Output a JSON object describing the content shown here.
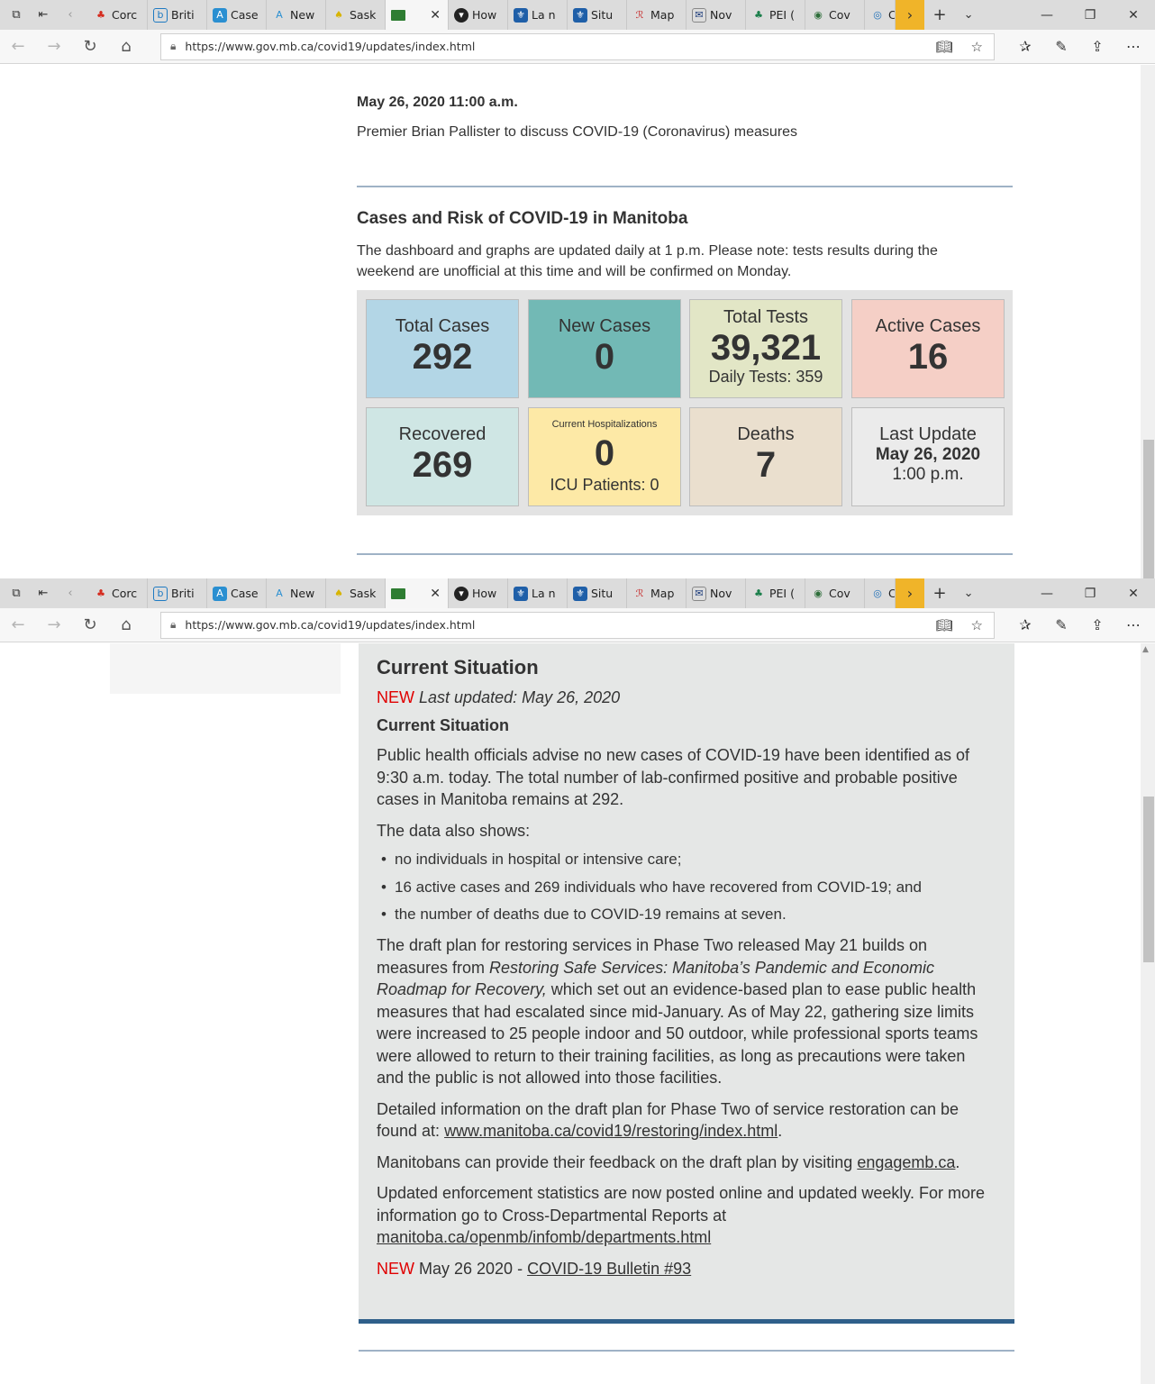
{
  "browser": {
    "tabs": [
      {
        "label": "Corc",
        "icon": "maple-leaf-icon"
      },
      {
        "label": "Briti",
        "icon": "bc-icon"
      },
      {
        "label": "Case",
        "icon": "alberta-icon"
      },
      {
        "label": "New",
        "icon": "alberta-icon"
      },
      {
        "label": "Sask",
        "icon": "sask-icon"
      },
      {
        "label": "",
        "icon": "manitoba-icon",
        "active": true
      },
      {
        "label": "How",
        "icon": "ontario-icon"
      },
      {
        "label": "La n",
        "icon": "quebec-icon"
      },
      {
        "label": "Situ",
        "icon": "quebec-icon"
      },
      {
        "label": "Map",
        "icon": "nb-icon"
      },
      {
        "label": "Nov",
        "icon": "ns-icon"
      },
      {
        "label": "PEI (",
        "icon": "pei-icon"
      },
      {
        "label": "Cov",
        "icon": "globe-icon"
      },
      {
        "label": "C",
        "icon": "nl-icon"
      }
    ],
    "url": "https://www.gov.mb.ca/covid19/updates/index.html"
  },
  "top": {
    "announcement_date": "May 26, 2020 11:00 a.m.",
    "announcement_text": "Premier Brian Pallister to discuss COVID-19 (Coronavirus) measures",
    "section_title": "Cases and Risk of COVID-19 in Manitoba",
    "section_desc": "The dashboard and graphs are updated daily at 1 p.m. Please note: tests results during the weekend are unofficial at this time and will be confirmed on Monday."
  },
  "dashboard": {
    "total_cases": {
      "label": "Total Cases",
      "value": "292"
    },
    "new_cases": {
      "label": "New Cases",
      "value": "0"
    },
    "total_tests": {
      "label": "Total Tests",
      "value": "39,321",
      "sub": "Daily Tests: 359"
    },
    "active_cases": {
      "label": "Active Cases",
      "value": "16"
    },
    "recovered": {
      "label": "Recovered",
      "value": "269"
    },
    "hospitalizations": {
      "label": "Current Hospitalizations",
      "value": "0",
      "sub": "ICU Patients: 0"
    },
    "deaths": {
      "label": "Deaths",
      "value": "7"
    },
    "last_update": {
      "label": "Last Update",
      "date": "May 26, 2020",
      "time": "1:00 p.m."
    },
    "colors": {
      "total_cases": "#b3d6e6",
      "new_cases": "#72b9b5",
      "total_tests": "#e2e6c6",
      "active_cases": "#f5cfc6",
      "recovered": "#cfe6e4",
      "hospitalizations": "#fde9a6",
      "deaths": "#eadfce",
      "last_update": "#ebebeb"
    }
  },
  "situation": {
    "title": "Current Situation",
    "new_tag": "NEW",
    "last_updated": "Last updated: May 26, 2020",
    "subtitle": "Current Situation",
    "p1": "Public health officials advise no new cases of COVID-19 have been identified as of 9:30 a.m. today. The total number of lab-confirmed positive and probable positive cases in Manitoba remains at 292.",
    "p2": "The data also shows:",
    "bullets": [
      "no individuals in hospital or intensive care;",
      "16 active cases and 269 individuals who have recovered from COVID-19; and",
      "the number of deaths due to COVID-19 remains at seven."
    ],
    "p3_before": "The draft plan for restoring services in Phase Two released May 21 builds on measures from ",
    "p3_italic": "Restoring Safe Services:  Manitoba’s Pandemic and Economic Roadmap for Recovery,",
    "p3_after": " which set out an evidence-based plan to ease public health measures that had escalated since mid-January. As of May 22, gathering size limits were increased to 25 people indoor and 50 outdoor, while professional sports teams were allowed to return to their training facilities, as long as precautions were taken and the public is not allowed into those facilities.",
    "p4_before": "Detailed information on the draft plan for Phase Two of service restoration can be found at: ",
    "p4_link": "www.manitoba.ca/covid19/restoring/index.html",
    "p4_after": ".",
    "p5_before": "Manitobans can provide their feedback on the draft plan by visiting ",
    "p5_link": "engagemb.ca",
    "p5_after": ".",
    "p6_before": "Updated enforcement statistics are now posted online and updated weekly. For more information go to Cross-Departmental Reports at ",
    "p6_link": "manitoba.ca/openmb/infomb/departments.html",
    "bulletin_new": "NEW",
    "bulletin_text": " May 26 2020 - ",
    "bulletin_link": "COVID-19 Bulletin #93"
  }
}
